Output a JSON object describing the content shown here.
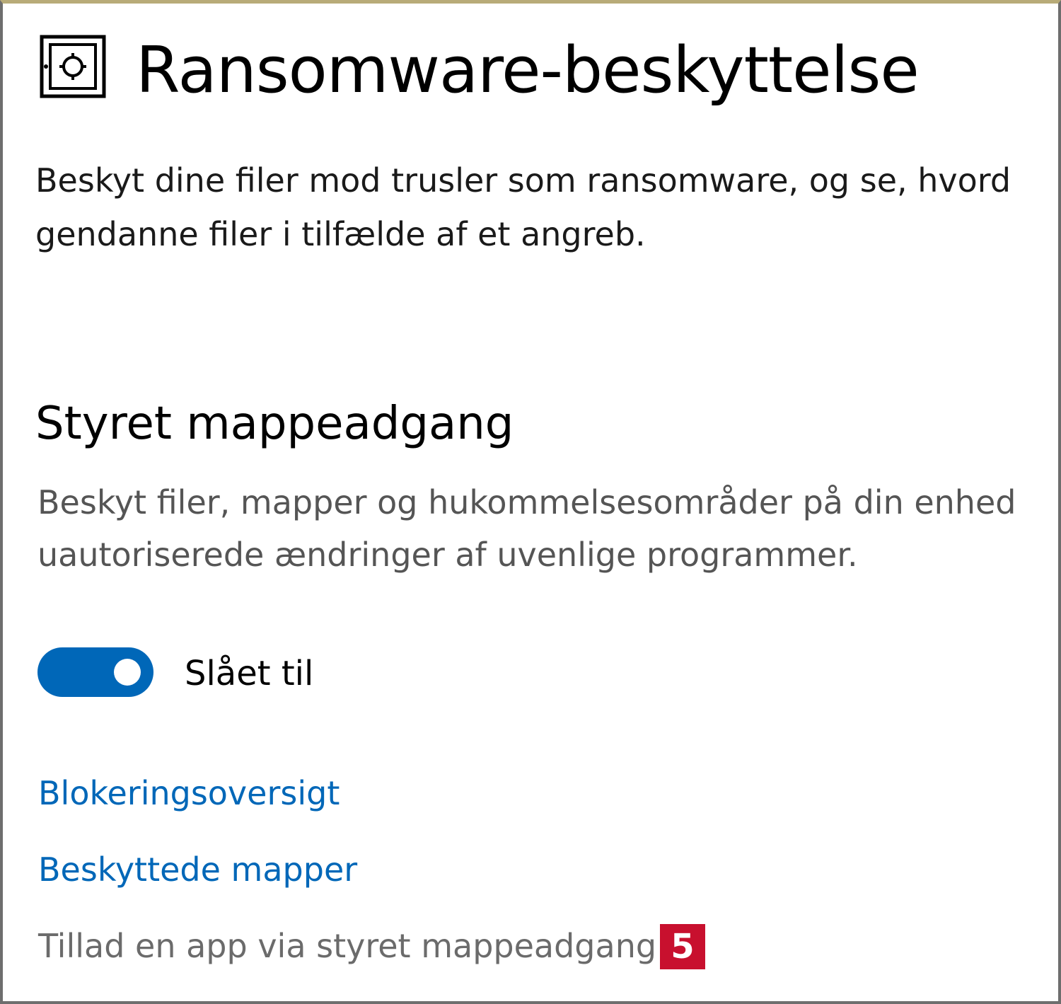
{
  "header": {
    "icon": "ransomware-shield-icon",
    "title": "Ransomware-beskyttelse",
    "description_line1": "Beskyt dine filer mod trusler som ransomware, og se, hvord",
    "description_line2": "gendanne filer i tilfælde af et angreb."
  },
  "controlled_folder_access": {
    "heading": "Styret mappeadgang",
    "description_line1": "Beskyt filer, mapper og hukommelsesområder på din enhed",
    "description_line2": "uautoriserede ændringer af uvenlige programmer.",
    "toggle": {
      "state": "on",
      "label": "Slået til"
    },
    "links": {
      "block_history": "Blokeringsoversigt",
      "protected_folders": "Beskyttede mapper",
      "allow_app": "Tillad en app via styret mappeadgang"
    }
  },
  "annotation": {
    "step_badge": "5"
  },
  "colors": {
    "accent": "#0067b8",
    "badge": "#c8102e",
    "secondary_text": "#555555"
  }
}
